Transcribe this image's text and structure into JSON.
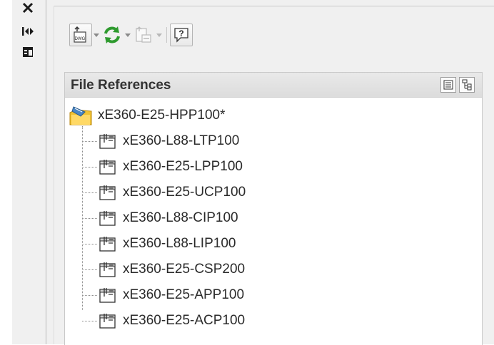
{
  "panel": {
    "title": "File References"
  },
  "tree": {
    "root": "xE360-E25-HPP100*",
    "children": [
      "xE360-L88-LTP100",
      "xE360-E25-LPP100",
      "xE360-E25-UCP100",
      "xE360-L88-CIP100",
      "xE360-L88-LIP100",
      "xE360-E25-CSP200",
      "xE360-E25-APP100",
      "xE360-E25-ACP100"
    ]
  },
  "toolbar": {
    "attach_icon_text": "DWG",
    "help_icon_text": "?"
  },
  "colors": {
    "refresh_green": "#2e9a2e",
    "panel_header": "#dcdcdc",
    "text": "#2b2b2b"
  },
  "icons": {
    "close": "close-icon",
    "auto_hide": "auto-hide-icon",
    "properties": "properties-icon",
    "attach": "attach-dwg-icon",
    "refresh": "refresh-icon",
    "change_path": "change-path-icon",
    "help": "help-icon",
    "list_view": "list-view-icon",
    "tree_view": "tree-view-icon",
    "drawing": "drawing-icon",
    "xref": "xref-icon"
  }
}
